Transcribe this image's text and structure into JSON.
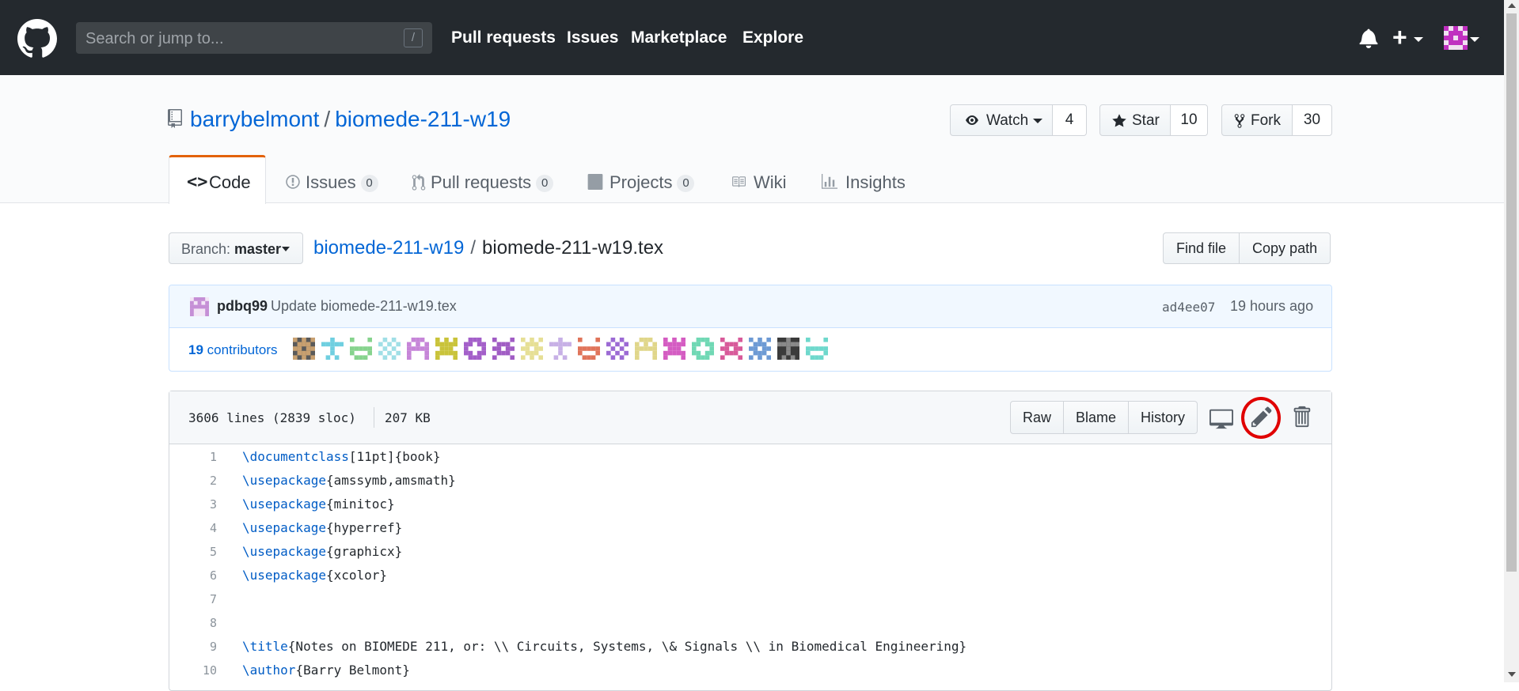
{
  "topbar": {
    "search_placeholder": "Search or jump to...",
    "slash_hint": "/",
    "nav": [
      "Pull requests",
      "Issues",
      "Marketplace",
      "Explore"
    ]
  },
  "repo": {
    "owner": "barrybelmont",
    "separator": "/",
    "name": "biomede-211-w19",
    "watch_label": "Watch",
    "watch_count": "4",
    "star_label": "Star",
    "star_count": "10",
    "fork_label": "Fork",
    "fork_count": "30"
  },
  "tabs": [
    {
      "label": "Code"
    },
    {
      "label": "Issues",
      "count": "0"
    },
    {
      "label": "Pull requests",
      "count": "0"
    },
    {
      "label": "Projects",
      "count": "0"
    },
    {
      "label": "Wiki"
    },
    {
      "label": "Insights"
    }
  ],
  "filenav": {
    "branch_prefix": "Branch:",
    "branch": "master",
    "crumb_root": "biomede-211-w19",
    "crumb_sep": "/",
    "crumb_file": "biomede-211-w19.tex",
    "find_file": "Find file",
    "copy_path": "Copy path"
  },
  "commit": {
    "author": "pdbq99",
    "message": "Update biomede-211-w19.tex",
    "sha": "ad4ee07",
    "time": "19 hours ago",
    "contributors_count": "19",
    "contributors_label": "contributors"
  },
  "file": {
    "lines_info": "3606 lines (2839 sloc)",
    "size": "207 KB",
    "raw": "Raw",
    "blame": "Blame",
    "history": "History"
  },
  "code_lines": [
    {
      "n": "1",
      "cmd": "\\documentclass",
      "rest": "[11pt]{book}"
    },
    {
      "n": "2",
      "cmd": "\\usepackage",
      "rest": "{amssymb,amsmath}"
    },
    {
      "n": "3",
      "cmd": "\\usepackage",
      "rest": "{minitoc}"
    },
    {
      "n": "4",
      "cmd": "\\usepackage",
      "rest": "{hyperref}"
    },
    {
      "n": "5",
      "cmd": "\\usepackage",
      "rest": "{graphicx}"
    },
    {
      "n": "6",
      "cmd": "\\usepackage",
      "rest": "{xcolor}"
    },
    {
      "n": "7",
      "cmd": "",
      "rest": ""
    },
    {
      "n": "8",
      "cmd": "",
      "rest": ""
    },
    {
      "n": "9",
      "cmd": "\\title",
      "rest": "{Notes on BIOMEDE 211, or: \\\\ Circuits, Systems, \\& Signals \\\\ in Biomedical Engineering}"
    },
    {
      "n": "10",
      "cmd": "\\author",
      "rest": "{Barry Belmont}"
    }
  ],
  "colors": {
    "header_bg": "#24292e",
    "link": "#0366d6",
    "tab_accent": "#e36209",
    "highlight_circle": "#e00000"
  }
}
